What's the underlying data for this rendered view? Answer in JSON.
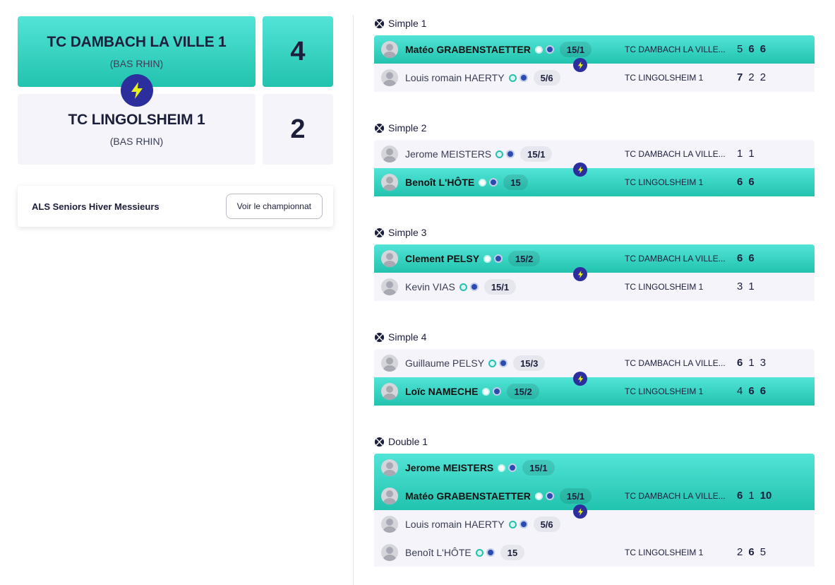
{
  "teams": {
    "home": {
      "name": "TC DAMBACH LA VILLE 1",
      "region": "(BAS RHIN)",
      "score": "4"
    },
    "away": {
      "name": "TC LINGOLSHEIM 1",
      "region": "(BAS RHIN)",
      "score": "2"
    }
  },
  "championship": {
    "title": "ALS Seniors Hiver Messieurs",
    "button_label": "Voir le championnat"
  },
  "colors": {
    "accent_teal": "#2ed1bd",
    "dark_blue": "#2b2e9c",
    "bolt_yellow": "#e8f21a",
    "light_bg": "#f4f4fa"
  },
  "icons": {
    "vs": "lightning-bolt-icon",
    "match": "tennis-ball-icon",
    "avatar": "user-avatar-icon"
  },
  "matches": [
    {
      "title": "Simple 1",
      "rows": [
        {
          "winner": true,
          "players": [
            {
              "name": "Matéo GRABENSTAETTER",
              "rank": "15/1"
            }
          ],
          "club": "TC DAMBACH LA VILLE...",
          "sets": [
            {
              "v": "5",
              "b": false
            },
            {
              "v": "6",
              "b": true
            },
            {
              "v": "6",
              "b": true
            }
          ]
        },
        {
          "winner": false,
          "players": [
            {
              "name": "Louis romain HAERTY",
              "rank": "5/6"
            }
          ],
          "club": "TC LINGOLSHEIM 1",
          "sets": [
            {
              "v": "7",
              "b": true
            },
            {
              "v": "2",
              "b": false
            },
            {
              "v": "2",
              "b": false
            }
          ]
        }
      ]
    },
    {
      "title": "Simple 2",
      "rows": [
        {
          "winner": false,
          "players": [
            {
              "name": "Jerome MEISTERS",
              "rank": "15/1"
            }
          ],
          "club": "TC DAMBACH LA VILLE...",
          "sets": [
            {
              "v": "1",
              "b": false
            },
            {
              "v": "1",
              "b": false
            }
          ]
        },
        {
          "winner": true,
          "players": [
            {
              "name": "Benoît L'HÔTE",
              "rank": "15"
            }
          ],
          "club": "TC LINGOLSHEIM 1",
          "sets": [
            {
              "v": "6",
              "b": true
            },
            {
              "v": "6",
              "b": true
            }
          ]
        }
      ]
    },
    {
      "title": "Simple 3",
      "rows": [
        {
          "winner": true,
          "players": [
            {
              "name": "Clement PELSY",
              "rank": "15/2"
            }
          ],
          "club": "TC DAMBACH LA VILLE...",
          "sets": [
            {
              "v": "6",
              "b": true
            },
            {
              "v": "6",
              "b": true
            }
          ]
        },
        {
          "winner": false,
          "players": [
            {
              "name": "Kevin VIAS",
              "rank": "15/1"
            }
          ],
          "club": "TC LINGOLSHEIM 1",
          "sets": [
            {
              "v": "3",
              "b": false
            },
            {
              "v": "1",
              "b": false
            }
          ]
        }
      ]
    },
    {
      "title": "Simple 4",
      "rows": [
        {
          "winner": false,
          "players": [
            {
              "name": "Guillaume PELSY",
              "rank": "15/3"
            }
          ],
          "club": "TC DAMBACH LA VILLE...",
          "sets": [
            {
              "v": "6",
              "b": true
            },
            {
              "v": "1",
              "b": false
            },
            {
              "v": "3",
              "b": false
            }
          ]
        },
        {
          "winner": true,
          "players": [
            {
              "name": "Loïc NAMECHE",
              "rank": "15/2"
            }
          ],
          "club": "TC LINGOLSHEIM 1",
          "sets": [
            {
              "v": "4",
              "b": false
            },
            {
              "v": "6",
              "b": true
            },
            {
              "v": "6",
              "b": true
            }
          ]
        }
      ]
    },
    {
      "title": "Double 1",
      "rows": [
        {
          "winner": true,
          "players": [
            {
              "name": "Jerome MEISTERS",
              "rank": "15/1"
            },
            {
              "name": "Matéo GRABENSTAETTER",
              "rank": "15/1"
            }
          ],
          "club": "TC DAMBACH LA VILLE...",
          "sets": [
            {
              "v": "6",
              "b": true
            },
            {
              "v": "1",
              "b": false
            },
            {
              "v": "10",
              "b": true
            }
          ]
        },
        {
          "winner": false,
          "players": [
            {
              "name": "Louis romain HAERTY",
              "rank": "5/6"
            },
            {
              "name": "Benoît L'HÔTE",
              "rank": "15"
            }
          ],
          "club": "TC LINGOLSHEIM 1",
          "sets": [
            {
              "v": "2",
              "b": false
            },
            {
              "v": "6",
              "b": true
            },
            {
              "v": "5",
              "b": false
            }
          ]
        }
      ]
    }
  ]
}
